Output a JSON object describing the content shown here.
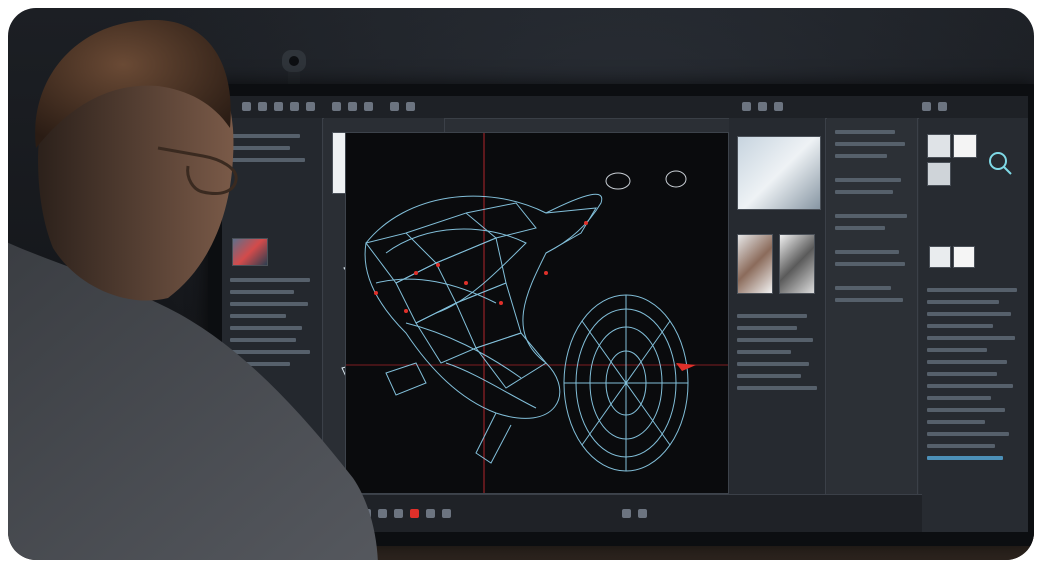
{
  "scene": {
    "subject": "person-at-monitor",
    "icons": {
      "viewport_model": "wireframe-motorcycle-icon",
      "webcam": "webcam-icon"
    }
  },
  "colors": {
    "wireframe": "#8fd3f0",
    "accent": "#e0302a",
    "ui_bg": "#2b2f35",
    "viewport_bg": "#0a0b0d"
  }
}
